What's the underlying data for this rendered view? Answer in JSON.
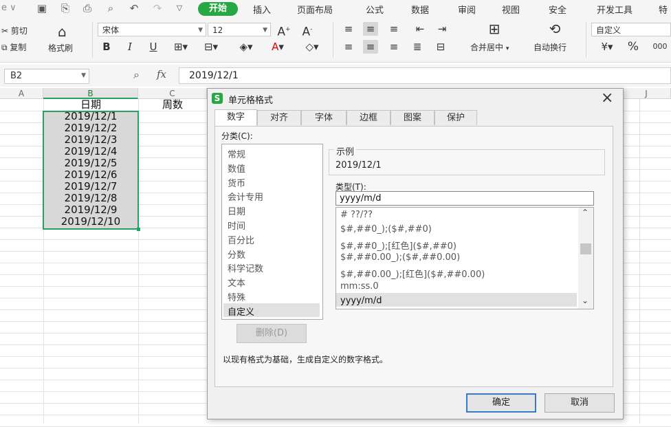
{
  "menubar": {
    "items": [
      "开始",
      "插入",
      "页面布局",
      "公式",
      "数据",
      "审阅",
      "视图",
      "安全",
      "开发工具",
      "特"
    ],
    "partial_left": "e ∨"
  },
  "ribbon": {
    "cut": "剪切",
    "copy": "复制",
    "format_painter": "格式刷",
    "font_name": "宋体",
    "font_size": "12",
    "merge_center": "合并居中",
    "wrap_text": "自动换行",
    "number_format": "自定义",
    "percent": "%",
    "thousands": "000"
  },
  "formula_bar": {
    "name_box": "B2",
    "fx": "fx",
    "value": "2019/12/1"
  },
  "grid": {
    "columns": [
      "A",
      "B",
      "C",
      "J"
    ],
    "header_b": "日期",
    "header_c": "周数",
    "dates": [
      "2019/12/1",
      "2019/12/2",
      "2019/12/3",
      "2019/12/4",
      "2019/12/5",
      "2019/12/6",
      "2019/12/7",
      "2019/12/8",
      "2019/12/9",
      "2019/12/10"
    ]
  },
  "dialog": {
    "title": "单元格格式",
    "close": "×",
    "tabs": [
      "数字",
      "对齐",
      "字体",
      "边框",
      "图案",
      "保护"
    ],
    "category_label": "分类(C):",
    "categories": [
      "常规",
      "数值",
      "货币",
      "会计专用",
      "日期",
      "时间",
      "百分比",
      "分数",
      "科学记数",
      "文本",
      "特殊",
      "自定义"
    ],
    "sample_label": "示例",
    "sample_value": "2019/12/1",
    "type_label": "类型(T):",
    "type_value": "yyyy/m/d",
    "formats": [
      "# ??/??",
      "$#,##0_);($#,##0)",
      "$#,##0_);[红色]($#,##0)",
      "$#,##0.00_);($#,##0.00)",
      "$#,##0.00_);[红色]($#,##0.00)",
      "mm:ss.0",
      "yyyy/m/d"
    ],
    "delete_button": "删除(D)",
    "description": "以现有格式为基础，生成自定义的数字格式。",
    "ok_button": "确定",
    "cancel_button": "取消"
  },
  "colors": {
    "accent_green": "#28a745",
    "selection_green": "#21a366",
    "ok_border": "#3a78c8"
  }
}
